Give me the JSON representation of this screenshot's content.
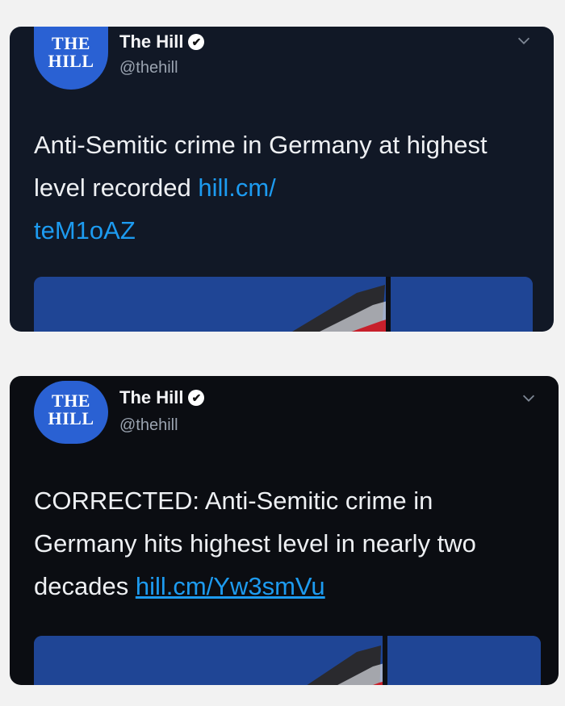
{
  "tweets": [
    {
      "avatar": {
        "line1": "THE",
        "line2": "HILL"
      },
      "name": "The Hill",
      "handle": "@thehill",
      "text": "Anti-Semitic crime in Germany at highest level recorded ",
      "link": "hill.cm/teM1oAZ",
      "link_part1": "hill.cm/",
      "link_part2": "teM1oAZ",
      "verified_icon": "verified-badge-icon",
      "menu_icon": "chevron-down-icon"
    },
    {
      "avatar": {
        "line1": "THE",
        "line2": "HILL"
      },
      "name": "The Hill",
      "handle": "@thehill",
      "text": "CORRECTED: Anti-Semitic crime in Germany hits highest level in nearly two decades ",
      "link": "hill.cm/Yw3smVu",
      "verified_icon": "verified-badge-icon",
      "menu_icon": "chevron-down-icon"
    }
  ],
  "colors": {
    "link": "#1d9bf0",
    "avatar_bg": "#2a61d3",
    "card_bg_1": "#111826",
    "card_bg_2": "#0b0d12"
  }
}
